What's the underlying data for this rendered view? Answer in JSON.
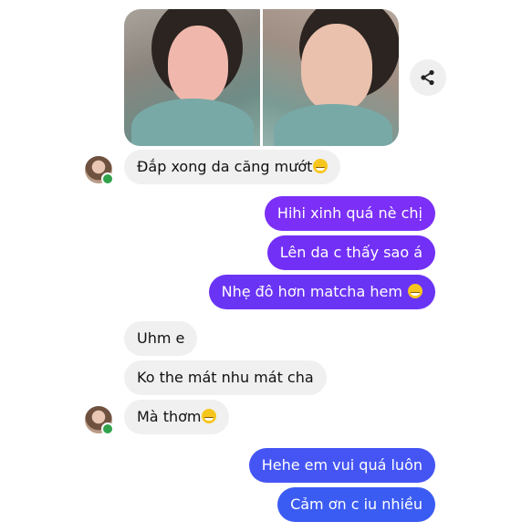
{
  "messages": {
    "m1": "Đắp xong da căng mướt",
    "m2": "Hihi xinh quá nè chị",
    "m3": "Lên da c thấy sao á",
    "m4": "Nhẹ đô hơn matcha hem",
    "m5": "Uhm e",
    "m6": "Ko the mát nhu mát cha",
    "m7": "Mà thơm",
    "m8": "Hehe em vui quá luôn",
    "m9": "Cảm ơn c iu nhiều"
  },
  "icons": {
    "share": "share-icon",
    "emoji_grin": "grinning-emoji",
    "emoji_grimace": "grimacing-emoji",
    "online": "online-dot"
  },
  "colors": {
    "incoming_bubble": "#f0f0f0",
    "outgoing_purple": "#7b2ff7",
    "outgoing_violet": "#6a34f5",
    "outgoing_blue": "#3b5cf3",
    "online_green": "#31a24c"
  }
}
